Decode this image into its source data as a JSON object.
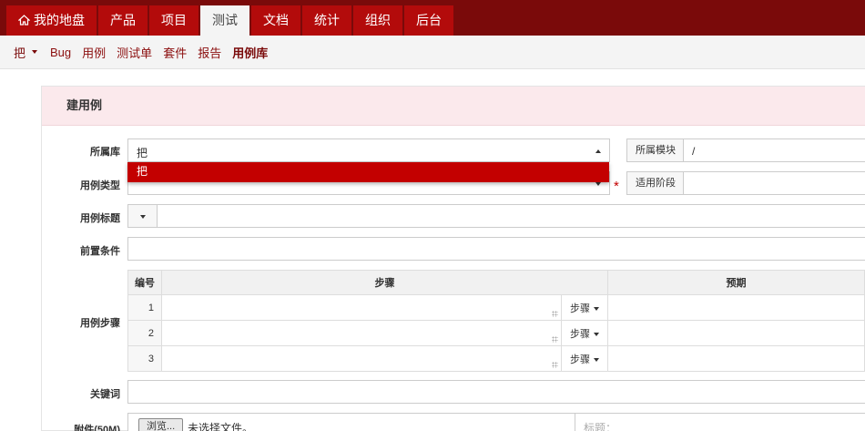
{
  "topnav": {
    "tabs": [
      {
        "label": "我的地盘",
        "active": false
      },
      {
        "label": "产品",
        "active": false
      },
      {
        "label": "项目",
        "active": false
      },
      {
        "label": "测试",
        "active": true
      },
      {
        "label": "文档",
        "active": false
      },
      {
        "label": "统计",
        "active": false
      },
      {
        "label": "组织",
        "active": false
      },
      {
        "label": "后台",
        "active": false
      }
    ]
  },
  "subnav": {
    "library": "把",
    "items": [
      {
        "label": "Bug",
        "active": false
      },
      {
        "label": "用例",
        "active": false
      },
      {
        "label": "测试单",
        "active": false
      },
      {
        "label": "套件",
        "active": false
      },
      {
        "label": "报告",
        "active": false
      },
      {
        "label": "用例库",
        "active": true
      }
    ]
  },
  "form": {
    "title": "建用例",
    "library_label": "所属库",
    "library_value": "把",
    "library_option": "把",
    "module_label": "所属模块",
    "module_value": "/",
    "type_label": "用例类型",
    "required_mark": "*",
    "stage_label": "适用阶段",
    "title_label": "用例标题",
    "precondition_label": "前置条件",
    "steps_label": "用例步骤",
    "steps": {
      "headers": [
        "编号",
        "步骤",
        "预期"
      ],
      "rows": [
        {
          "num": "1",
          "type": "步骤"
        },
        {
          "num": "2",
          "type": "步骤"
        },
        {
          "num": "3",
          "type": "步骤"
        }
      ]
    },
    "keywords_label": "关键词",
    "attachment_label": "附件(50M)",
    "browse_button": "浏览...",
    "no_file": "未选择文件。",
    "file_title_placeholder": "标题："
  },
  "colors": {
    "brand_dark": "#7a0a0a",
    "brand": "#b30b0b",
    "selected": "#c30000",
    "head_bg": "#fbe9ec"
  }
}
